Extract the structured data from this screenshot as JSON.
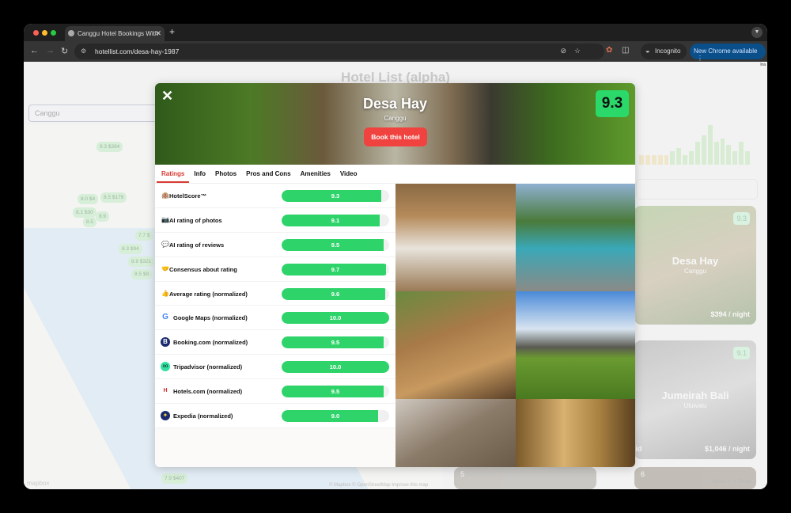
{
  "browser": {
    "tab_title": "Canggu Hotel Bookings With",
    "url": "hotellist.com/desa-hay-1987",
    "incognito_label": "Incognito",
    "update_label": "New Chrome available"
  },
  "page": {
    "title": "Hotel List (alpha)",
    "search_value": "Canggu",
    "lang_badge": "lna",
    "map_attribution": "© Mapbox © OpenStreetMap Improve this map",
    "mapbox_logo": "mapbox",
    "feedback": "Ideas + ☺ Bugs",
    "map_markers": [
      "9.3 $394",
      "8.0 $4",
      "8.5 $179",
      "8.1 $30",
      "8.9",
      "8.5",
      "7.7 $",
      "8.3 $94",
      "8.9 $321",
      "8.5 $8",
      "7.9 $407"
    ],
    "price_histogram": [
      3,
      3,
      3,
      3,
      3,
      4,
      5,
      3,
      4,
      7,
      9,
      12,
      7,
      8,
      6,
      4,
      7,
      4
    ],
    "cards": [
      {
        "name": "Desa Hay",
        "location": "Canggu",
        "score": "9.3",
        "price": "$394 / night"
      },
      {
        "name": "Jumeirah Bali",
        "location": "Uluwatu",
        "score": "9.1",
        "price": "$1,046 / night",
        "extra": "old"
      }
    ],
    "next_cards": [
      "5",
      "6"
    ]
  },
  "modal": {
    "close_label": "✕",
    "hotel_name": "Desa Hay",
    "location": "Canggu",
    "book_label": "Book this hotel",
    "score": "9.3",
    "tabs": [
      "Ratings",
      "Info",
      "Photos",
      "Pros and Cons",
      "Amenities",
      "Video"
    ],
    "ratings": [
      {
        "icon": "🏨",
        "label": "HotelScore™",
        "value": "9.3",
        "fraction": 0.93
      },
      {
        "icon": "📷",
        "label": "AI rating of photos",
        "value": "9.1",
        "fraction": 0.91
      },
      {
        "icon": "💬",
        "label": "AI rating of reviews",
        "value": "9.5",
        "fraction": 0.95
      },
      {
        "icon": "🤝",
        "label": "Consensus about rating",
        "value": "9.7",
        "fraction": 0.97
      },
      {
        "icon": "👍",
        "label": "Average rating (normalized)",
        "value": "9.6",
        "fraction": 0.96
      },
      {
        "icon": "G",
        "label": "Google Maps (normalized)",
        "value": "10.0",
        "fraction": 1.0
      },
      {
        "icon": "B",
        "label": "Booking.com (normalized)",
        "value": "9.5",
        "fraction": 0.95
      },
      {
        "icon": "oo",
        "label": "Tripadvisor (normalized)",
        "value": "10.0",
        "fraction": 1.0
      },
      {
        "icon": "H",
        "label": "Hotels.com (normalized)",
        "value": "9.5",
        "fraction": 0.95
      },
      {
        "icon": "✦",
        "label": "Expedia (normalized)",
        "value": "9.0",
        "fraction": 0.9
      }
    ]
  },
  "colors": {
    "accent_red": "#f0433f",
    "score_green": "#2bd96a",
    "tab_active": "#d93a32"
  }
}
